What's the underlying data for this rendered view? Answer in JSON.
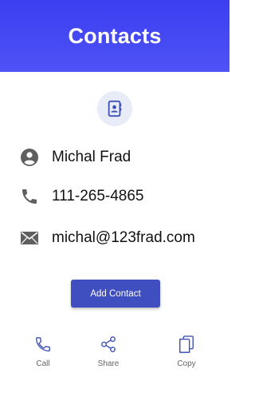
{
  "header": {
    "title": "Contacts"
  },
  "contact": {
    "name": "Michal Frad",
    "phone": "111-265-4865",
    "email": "michal@123frad.com"
  },
  "add_button": {
    "label": "Add Contact"
  },
  "actions": [
    {
      "label": "Call",
      "icon": "phone-outline-icon",
      "color": "#3f51b5"
    },
    {
      "label": "Share",
      "icon": "share-icon",
      "color": "#3f51b5"
    },
    {
      "label": "Copy",
      "icon": "copy-icon",
      "color": "#3f51b5"
    }
  ],
  "colors": {
    "header": "#4346f2",
    "accent": "#3f4fc0",
    "icon_grey": "#5f5f5f",
    "badge_bg": "#e8ecf7"
  }
}
